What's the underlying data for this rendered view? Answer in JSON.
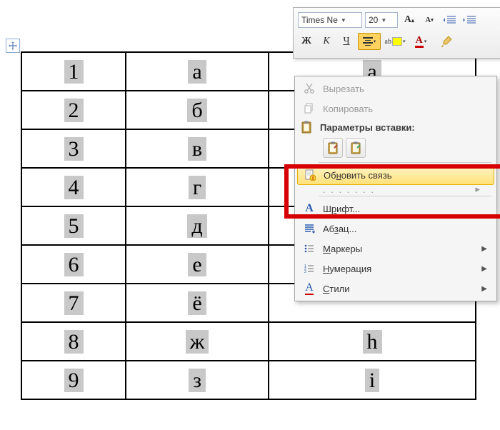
{
  "toolbar": {
    "font_name": "Times Ne",
    "font_size": "20",
    "bold": "Ж",
    "italic": "К",
    "underline": "Ч"
  },
  "table": {
    "rows": [
      {
        "n": "1",
        "a": "а",
        "b": "a"
      },
      {
        "n": "2",
        "a": "б",
        "b": ""
      },
      {
        "n": "3",
        "a": "в",
        "b": ""
      },
      {
        "n": "4",
        "a": "г",
        "b": ""
      },
      {
        "n": "5",
        "a": "д",
        "b": ""
      },
      {
        "n": "6",
        "a": "е",
        "b": ""
      },
      {
        "n": "7",
        "a": "ё",
        "b": ""
      },
      {
        "n": "8",
        "a": "ж",
        "b": "h"
      },
      {
        "n": "9",
        "a": "з",
        "b": "i"
      }
    ]
  },
  "menu": {
    "cut": "Вырезать",
    "copy": "Копировать",
    "paste_header": "Параметры вставки:",
    "update_link_pre": "Об",
    "update_link_u": "н",
    "update_link_post": "овить связь",
    "font_pre": "Ш",
    "font_u": "р",
    "font_post": "ифт...",
    "para_pre": "Аб",
    "para_u": "з",
    "para_post": "ац...",
    "bullets_pre": "",
    "bullets_u": "М",
    "bullets_post": "аркеры",
    "numbering_pre": "",
    "numbering_u": "Н",
    "numbering_post": "умерация",
    "styles_pre": "",
    "styles_u": "С",
    "styles_post": "тили"
  }
}
